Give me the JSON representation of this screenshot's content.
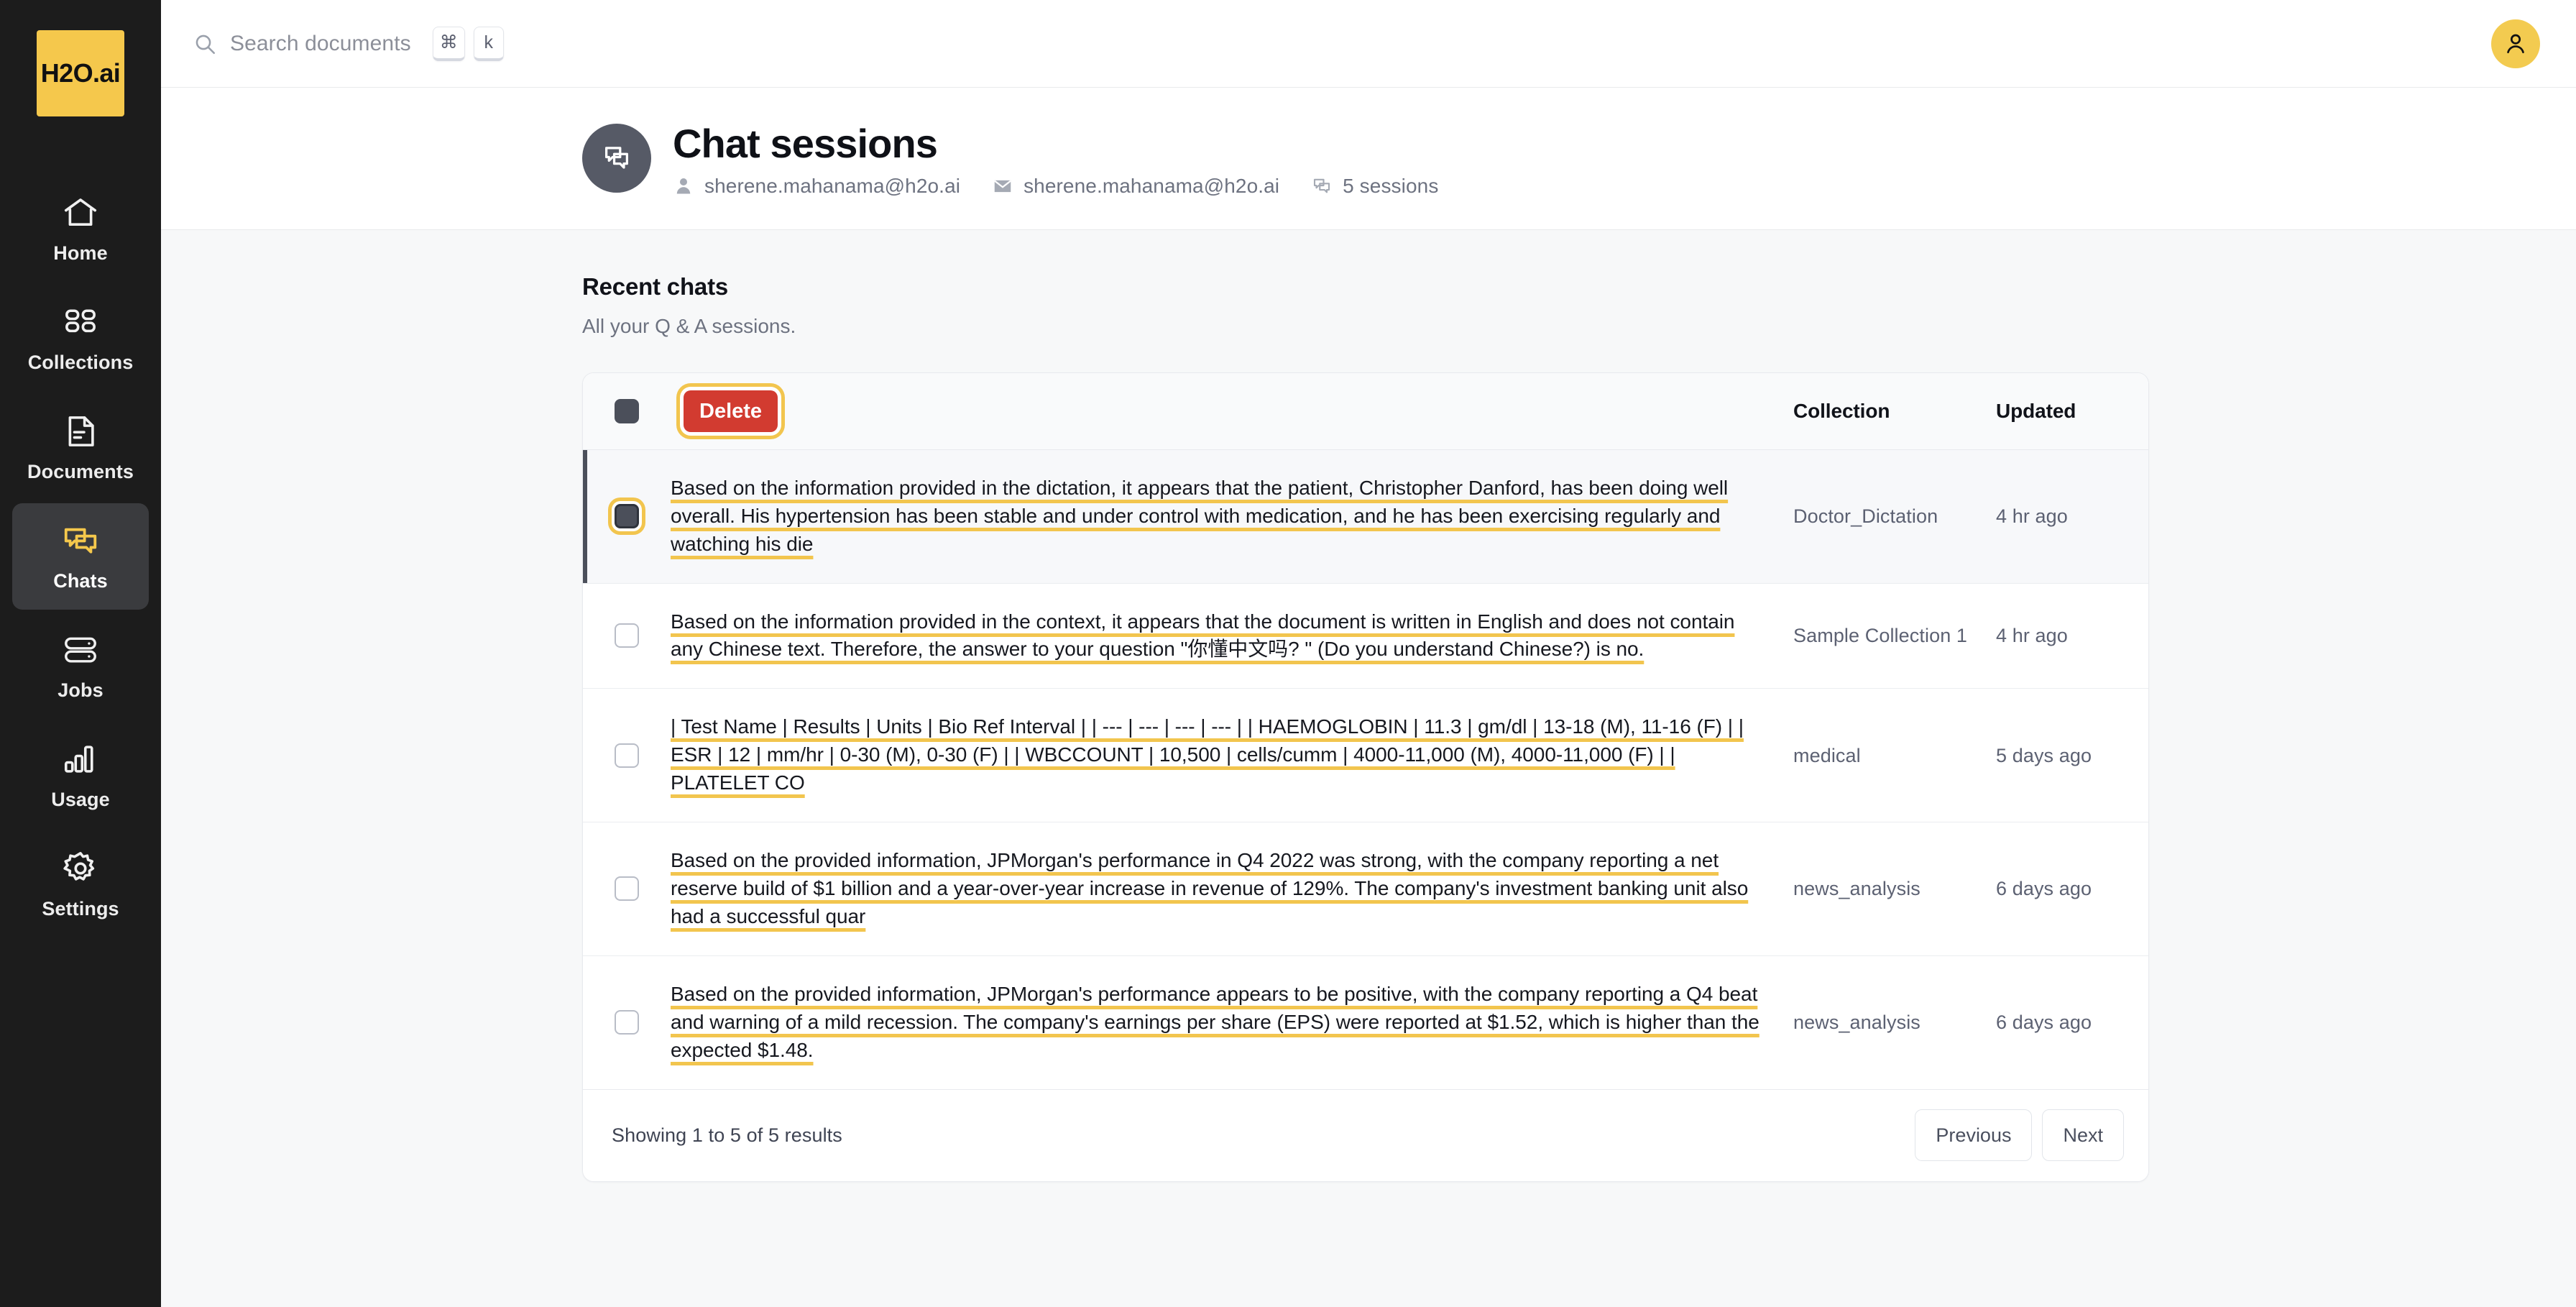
{
  "brand": {
    "name": "H2O.ai"
  },
  "sidebar": {
    "items": [
      {
        "label": "Home",
        "icon": "home-icon",
        "active": false
      },
      {
        "label": "Collections",
        "icon": "collections-icon",
        "active": false
      },
      {
        "label": "Documents",
        "icon": "document-icon",
        "active": false
      },
      {
        "label": "Chats",
        "icon": "chat-icon",
        "active": true
      },
      {
        "label": "Jobs",
        "icon": "jobs-icon",
        "active": false
      },
      {
        "label": "Usage",
        "icon": "usage-icon",
        "active": false
      },
      {
        "label": "Settings",
        "icon": "gear-icon",
        "active": false
      }
    ]
  },
  "topbar": {
    "search": {
      "placeholder": "Search documents",
      "value": ""
    },
    "shortcut_keys": [
      "⌘",
      "k"
    ]
  },
  "page": {
    "title": "Chat sessions",
    "meta": [
      {
        "icon": "user-icon",
        "text": "sherene.mahanama@h2o.ai"
      },
      {
        "icon": "mail-icon",
        "text": "sherene.mahanama@h2o.ai"
      },
      {
        "icon": "chat-bubble-icon",
        "text": "5 sessions"
      }
    ]
  },
  "section": {
    "title": "Recent chats",
    "subtitle": "All your Q & A sessions."
  },
  "table": {
    "delete_label": "Delete",
    "headers": {
      "collection": "Collection",
      "updated": "Updated"
    },
    "rows": [
      {
        "title": "Based on the information provided in the dictation, it appears that the patient, Christopher Danford, has been doing well overall. His hypertension has been stable and under control with medication, and he has been exercising regularly and watching his die",
        "collection": "Doctor_Dictation",
        "updated": "4 hr ago",
        "selected": true
      },
      {
        "title": "Based on the information provided in the context, it appears that the document is written in English and does not contain any Chinese text. Therefore, the answer to your question \"你懂中文吗? \" (Do you understand Chinese?) is no.",
        "collection": "Sample Collection 1",
        "updated": "4 hr ago",
        "selected": false
      },
      {
        "title": "| Test Name | Results | Units | Bio Ref Interval | | --- | --- | --- | --- | | HAEMOGLOBIN | 11.3 | gm/dl | 13-18 (M), 11-16 (F) | | ESR | 12 | mm/hr | 0-30 (M), 0-30 (F) | | WBCCOUNT | 10,500 | cells/cumm | 4000-11,000 (M), 4000-11,000 (F) | | PLATELET CO",
        "collection": "medical",
        "updated": "5 days ago",
        "selected": false
      },
      {
        "title": "Based on the provided information, JPMorgan's performance in Q4 2022 was strong, with the company reporting a net reserve build of $1 billion and a year-over-year increase in revenue of 129%. The company's investment banking unit also had a successful quar",
        "collection": "news_analysis",
        "updated": "6 days ago",
        "selected": false
      },
      {
        "title": "Based on the provided information, JPMorgan's performance appears to be positive, with the company reporting a Q4 beat and warning of a mild recession. The company's earnings per share (EPS) were reported at $1.52, which is higher than the expected $1.48.",
        "collection": "news_analysis",
        "updated": "6 days ago",
        "selected": false
      }
    ],
    "footer": {
      "showing": "Showing 1 to 5 of 5 results",
      "previous": "Previous",
      "next": "Next"
    }
  },
  "colors": {
    "brand_yellow": "#f5c84c",
    "focus_ring": "#f2c54e",
    "danger": "#d23b30",
    "sidebar_bg": "#1c1c1c",
    "page_bg": "#f7f8f9",
    "underline": "#f2c54e"
  }
}
